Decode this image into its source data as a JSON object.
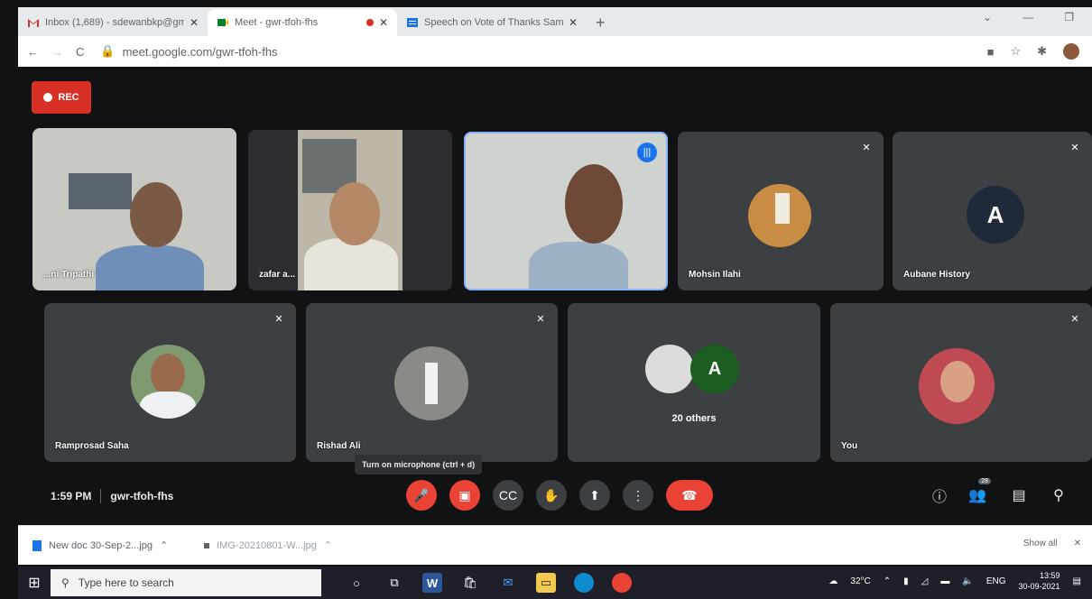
{
  "browser": {
    "tabs": [
      {
        "title": "Inbox (1,689) - sdewanbkp@gm",
        "close": "✕",
        "active": false
      },
      {
        "title": "Meet - gwr-tfoh-fhs",
        "close": "✕",
        "active": true,
        "recording": true
      },
      {
        "title": "Speech on Vote of Thanks Samp",
        "close": "✕",
        "active": false
      }
    ],
    "new_tab": "+",
    "url": "meet.google.com/gwr-tfoh-fhs"
  },
  "meet": {
    "rec_label": "REC",
    "participants": [
      {
        "name": "...ni Tripathi",
        "muted": false,
        "kind": "video"
      },
      {
        "name": "zafar a...",
        "muted": false,
        "kind": "video"
      },
      {
        "name": "",
        "muted": false,
        "kind": "video",
        "speaking": true
      },
      {
        "name": "Mohsin Ilahi",
        "muted": true,
        "kind": "photo"
      },
      {
        "name": "Aubane History",
        "muted": true,
        "kind": "letter",
        "letter": "A"
      },
      {
        "name": "Ramprosad Saha",
        "muted": true,
        "kind": "photo"
      },
      {
        "name": "Rishad Ali",
        "muted": true,
        "kind": "photo"
      },
      {
        "name": "20 others",
        "muted": false,
        "kind": "group",
        "letter": "A"
      },
      {
        "name": "You",
        "muted": true,
        "kind": "photo"
      }
    ],
    "tooltip": "Turn on microphone (ctrl + d)",
    "time": "1:59 PM",
    "meeting_code": "gwr-tfoh-fhs",
    "people_count": "28"
  },
  "downloads": {
    "items": [
      "New doc 30-Sep-2...jpg",
      "IMG-20210801-W...jpg"
    ],
    "show_all": "Show all",
    "close": "✕"
  },
  "taskbar": {
    "search_placeholder": "Type here to search",
    "temperature": "32°C",
    "lang": "ENG",
    "time": "13:59",
    "date": "30-09-2021"
  },
  "colors": {
    "meet_bg": "#111214",
    "hangup": "#ea4335",
    "speaking": "#1a73e8",
    "rec": "#d93025"
  }
}
